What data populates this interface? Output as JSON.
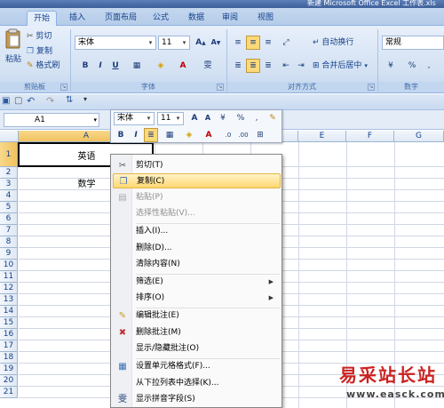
{
  "window": {
    "title": "新建 Microsoft Office Excel 工作表.xls"
  },
  "tabs": [
    "开始",
    "插入",
    "页面布局",
    "公式",
    "数据",
    "审阅",
    "视图"
  ],
  "ribbon": {
    "clipboard": {
      "paste": "粘贴",
      "cut": "剪切",
      "copy": "复制",
      "format_painter": "格式刷",
      "label": "剪贴板"
    },
    "font": {
      "name": "宋体",
      "size": "11",
      "label": "字体",
      "bold": "B",
      "italic": "I",
      "underline": "U"
    },
    "alignment": {
      "wrap": "自动换行",
      "merge": "合并后居中",
      "label": "对齐方式"
    },
    "number": {
      "format": "常规",
      "percent": "%",
      "comma": ",",
      "label": "数字"
    }
  },
  "formula_bar": {
    "name_box": "A1"
  },
  "grid": {
    "columns": [
      "A",
      "B",
      "C",
      "D",
      "E",
      "F",
      "G"
    ],
    "rows": [
      "1",
      "2",
      "3",
      "4",
      "5",
      "6",
      "7",
      "8",
      "9",
      "10",
      "11",
      "12",
      "13",
      "14",
      "15",
      "16",
      "17",
      "18",
      "19",
      "20",
      "21"
    ],
    "cells": {
      "A1": "英语",
      "A2": "数学"
    }
  },
  "mini_toolbar": {
    "font": "宋体",
    "size": "11",
    "percent": "%",
    "comma": ","
  },
  "context_menu": {
    "cut": "剪切(T)",
    "copy": "复制(C)",
    "paste": "粘贴(P)",
    "paste_special": "选择性粘贴(V)...",
    "insert": "插入(I)...",
    "delete": "删除(D)...",
    "clear": "清除内容(N)",
    "filter": "筛选(E)",
    "sort": "排序(O)",
    "edit_comment": "编辑批注(E)",
    "delete_comment": "删除批注(M)",
    "show_hide_comment": "显示/隐藏批注(O)",
    "format_cells": "设置单元格格式(F)...",
    "pick_list": "从下拉列表中选择(K)...",
    "phonetic": "显示拼音字段(S)"
  },
  "watermark": {
    "cn": "易采站长站",
    "url": "www.easck.com"
  },
  "colors": {
    "accent": "#15428b",
    "highlight": "#ffd770",
    "watermark": "#cc2222"
  }
}
